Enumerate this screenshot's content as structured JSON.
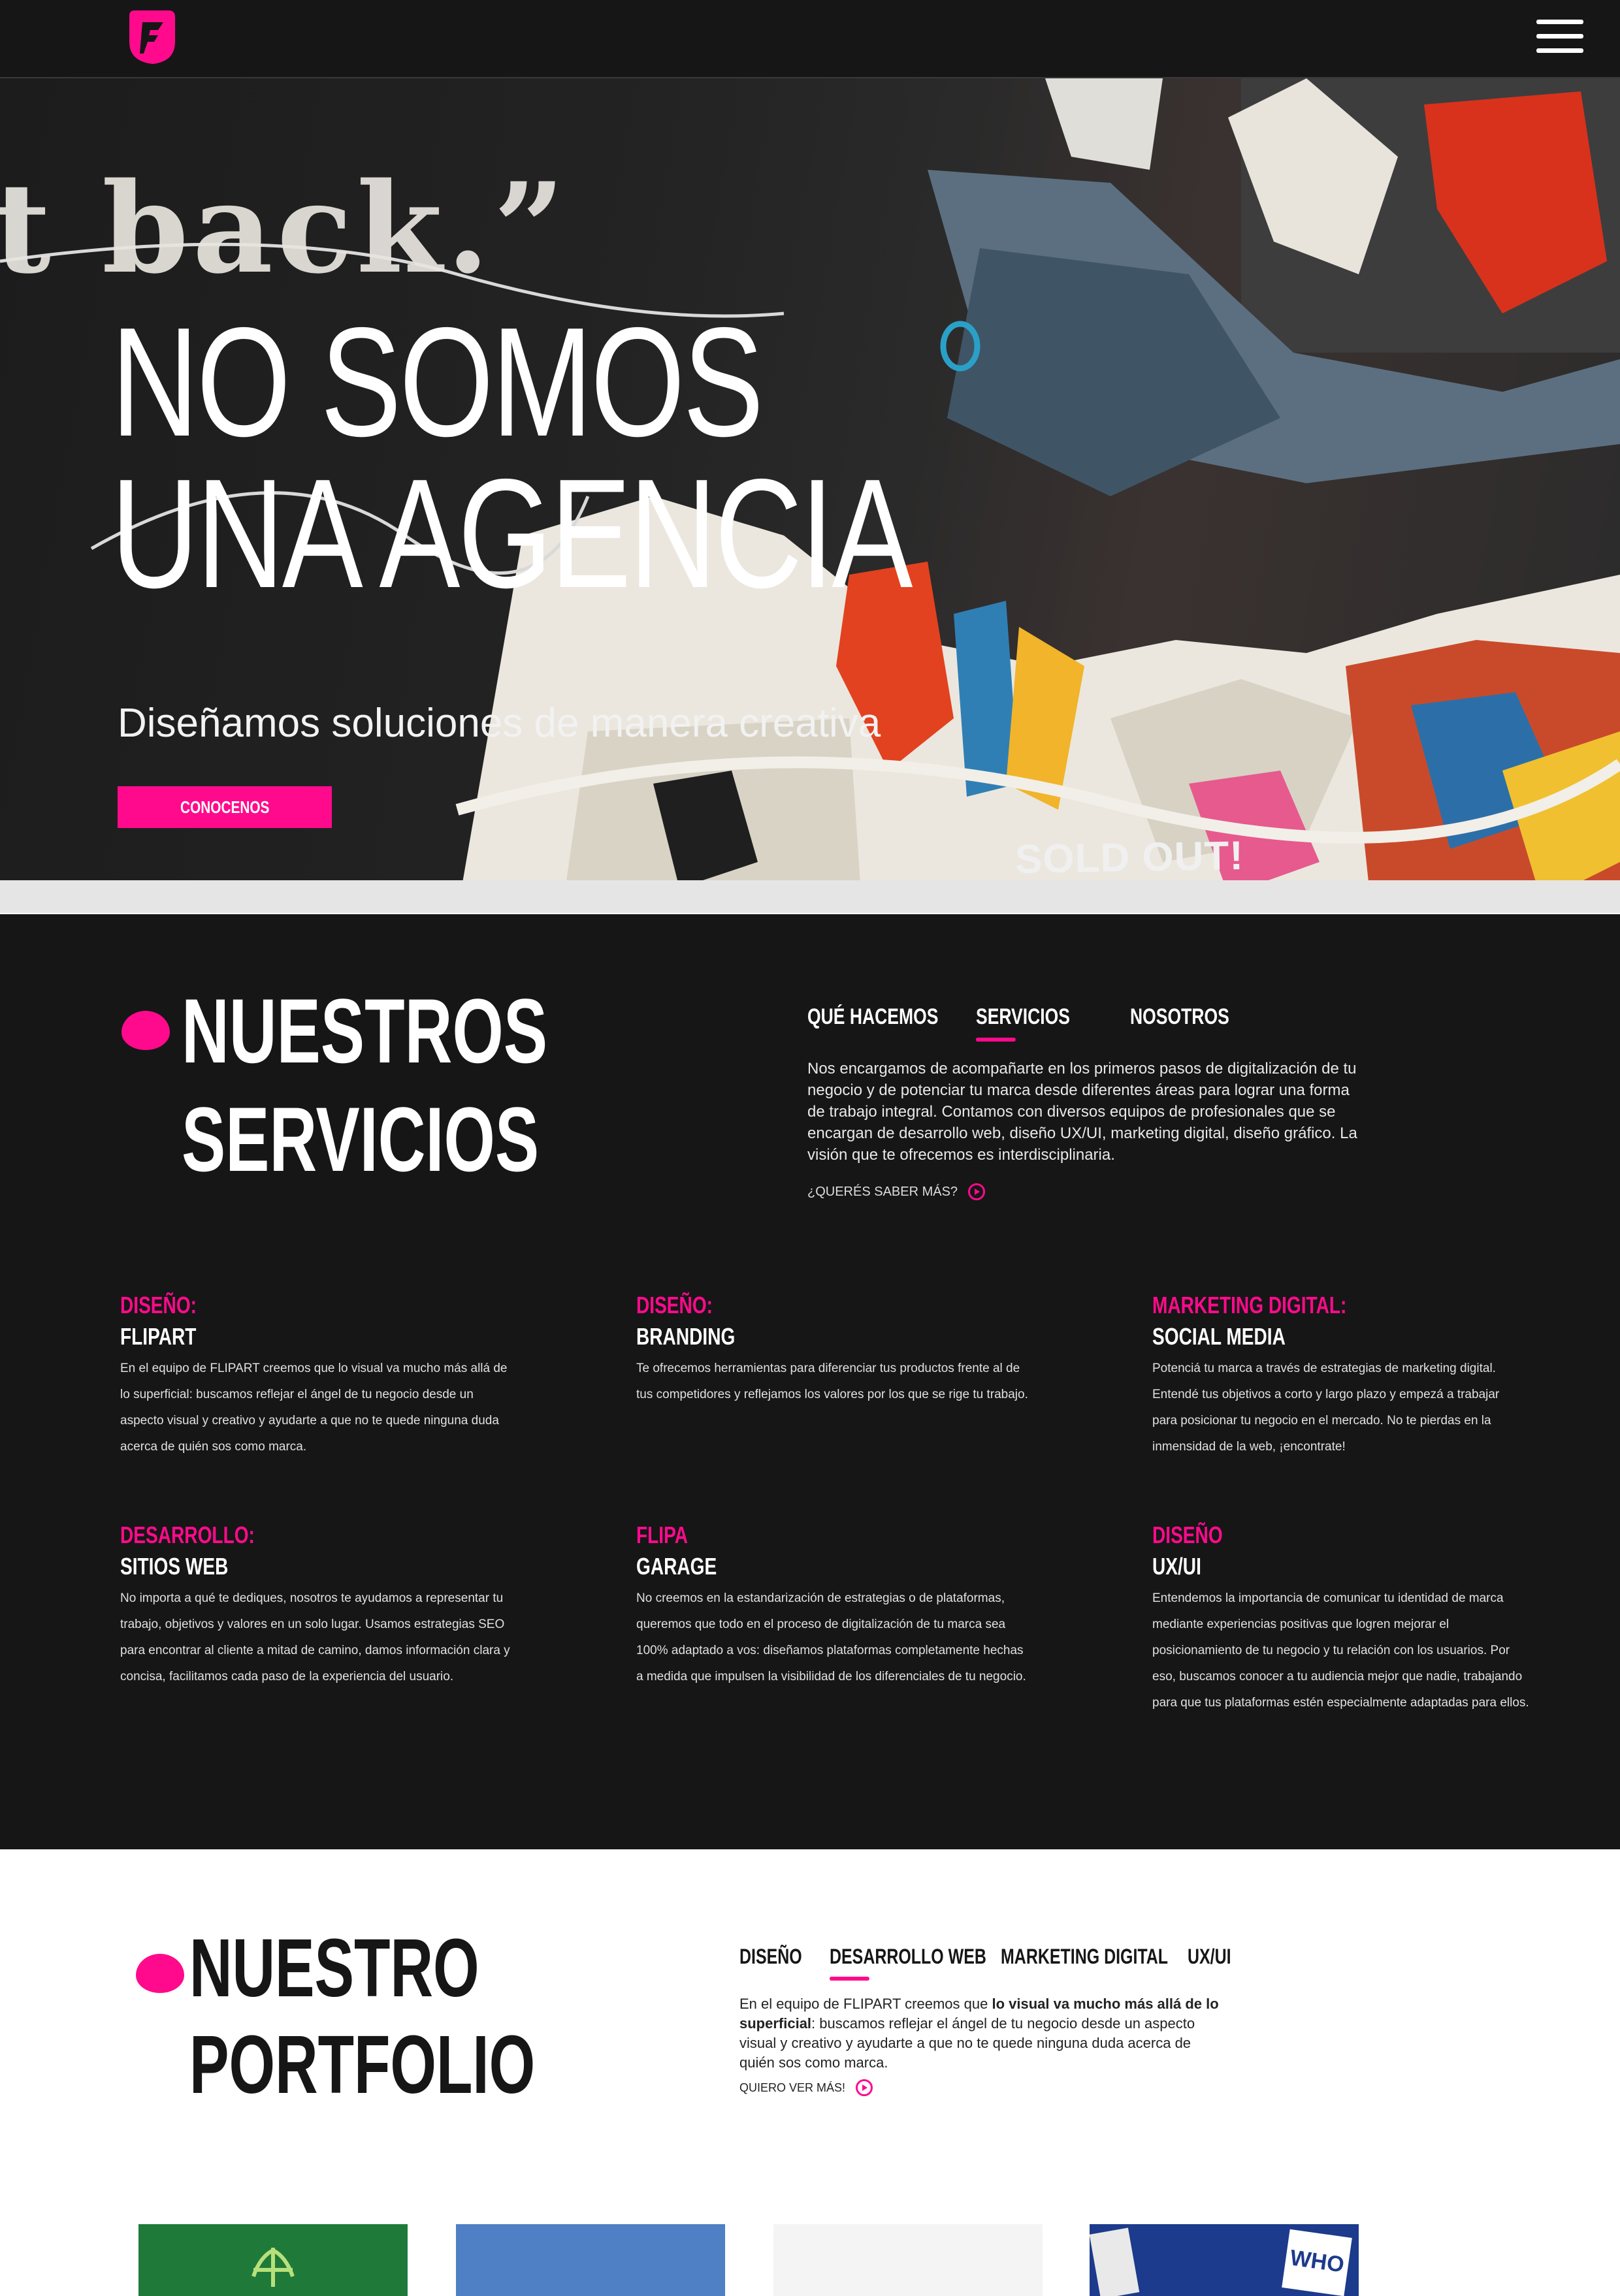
{
  "nav": {
    "logo_icon": "flipart-logo-icon",
    "menu_icon": "hamburger-menu-icon"
  },
  "hero": {
    "background_text": "t back.”",
    "title_line1": "NO SOMOS",
    "title_line2": "UNA AGENCIA",
    "subtitle": "Diseñamos soluciones de manera creativa",
    "button": "CONOCENOS",
    "poster_text": "SOLD OUT!"
  },
  "services": {
    "title_line1": "NUESTROS",
    "title_line2": "SERVICIOS",
    "tabs": [
      {
        "label": "QUÉ HACEMOS",
        "active": false
      },
      {
        "label": "SERVICIOS",
        "active": true
      },
      {
        "label": "NOSOTROS",
        "active": false
      }
    ],
    "paragraph": "Nos encargamos de acompañarte en los primeros pasos de digitalización de tu negocio y de potenciar tu marca desde diferentes áreas para lograr una forma de trabajo integral. Contamos con diversos equipos de profesionales que se encargan de desarrollo web, diseño UX/UI, marketing digital, diseño gráfico. La visión que te ofrecemos es interdisciplinaria.",
    "more_link": "¿QUERÉS SABER MÁS?",
    "items": [
      {
        "category": "DISEÑO:",
        "name": "FLIPART",
        "text": "En el equipo de FLIPART creemos que lo visual va mucho más allá de lo superficial: buscamos reflejar el ángel de tu negocio desde un aspecto visual y creativo y ayudarte a que no te quede ninguna duda acerca de quién sos como marca."
      },
      {
        "category": "DISEÑO:",
        "name": "BRANDING",
        "text": "Te ofrecemos herramientas para diferenciar tus productos frente al de tus competidores y reflejamos los valores por los que se rige tu trabajo."
      },
      {
        "category": "MARKETING DIGITAL:",
        "name": "SOCIAL MEDIA",
        "text": "Potenciá tu marca a través de estrategias de marketing digital. Entendé tus objetivos a corto y largo plazo y empezá a trabajar para posicionar tu negocio en el mercado. No te pierdas en la inmensidad de la web, ¡encontrate!"
      },
      {
        "category": "DESARROLLO:",
        "name": "SITIOS WEB",
        "text": "No importa a qué te dediques, nosotros te ayudamos a representar tu trabajo, objetivos y valores en un solo lugar. Usamos estrategias SEO para encontrar al cliente a mitad de camino, damos información clara y concisa, facilitamos cada paso de la experiencia del usuario."
      },
      {
        "category": "FLIPA",
        "name": "GARAGE",
        "text": "No creemos en la estandarización de estrategias o de plataformas, queremos que todo en el proceso de digitalización de tu marca sea 100% adaptado a vos: diseñamos plataformas completamente hechas a medida que impulsen la visibilidad de los diferenciales de tu negocio."
      },
      {
        "category": "DISEÑO",
        "name": "UX/UI",
        "text": "Entendemos la importancia de comunicar tu identidad de marca mediante experiencias positivas que logren mejorar el posicionamiento de tu negocio y tu relación con los usuarios. Por eso, buscamos conocer a tu audiencia mejor que nadie, trabajando para que tus plataformas estén especialmente adaptadas para ellos."
      }
    ]
  },
  "portfolio": {
    "title_line1": "NUESTRO",
    "title_line2": "PORTFOLIO",
    "tabs": [
      {
        "label": "DISEÑO",
        "active": false
      },
      {
        "label": "DESARROLLO WEB",
        "active": true
      },
      {
        "label": "MARKETING DIGITAL",
        "active": false
      },
      {
        "label": "UX/UI",
        "active": false
      }
    ],
    "para_start": "En el equipo de FLIPART creemos que ",
    "para_bold": "lo visual va mucho más allá de lo superficial",
    "para_end": ": buscamos reflejar el ángel de tu negocio desde un aspecto visual y creativo y ayudarte a que no te quede ninguna duda acerca de quién sos como marca.",
    "more_link": "QUIERO VER MÁS!",
    "thumb_text": "WHO",
    "thumb_colors": [
      "#1f7a3a",
      "#4f7fc4",
      "#f4f4f4",
      "#1d3b8c"
    ]
  },
  "colors": {
    "accent": "#ff0a8c",
    "dark": "#161616"
  }
}
